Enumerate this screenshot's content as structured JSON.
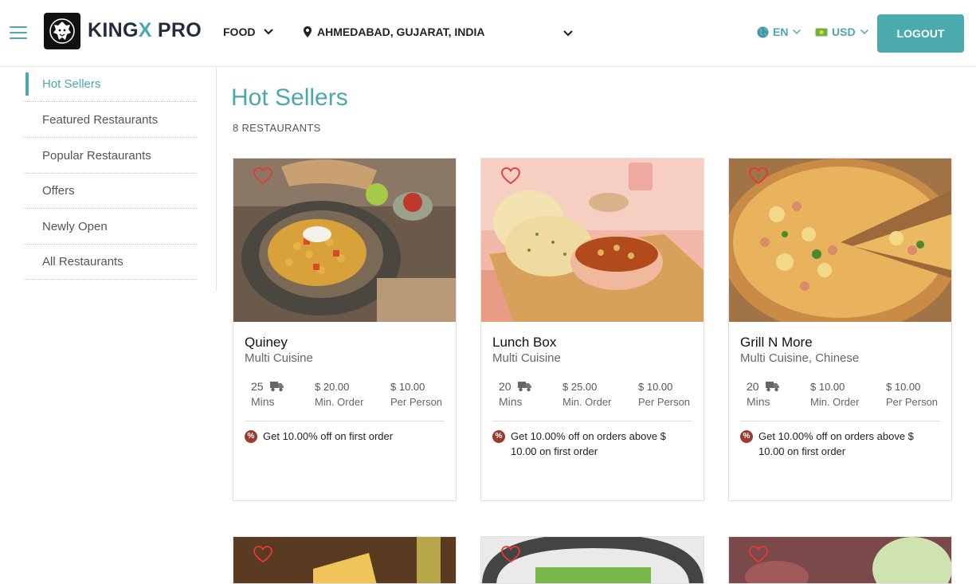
{
  "header": {
    "brand_main": "KINGX",
    "brand_tail": " PRO",
    "service": "FOOD",
    "location": "AHMEDABAD, GUJARAT, INDIA",
    "language": "EN",
    "currency": "USD",
    "logout": "LOGOUT"
  },
  "sidebar": {
    "items": [
      {
        "label": "Hot Sellers"
      },
      {
        "label": "Featured Restaurants"
      },
      {
        "label": "Popular Restaurants"
      },
      {
        "label": "Offers"
      },
      {
        "label": "Newly Open"
      },
      {
        "label": "All Restaurants"
      }
    ]
  },
  "main": {
    "title": "Hot Sellers",
    "count": "8 RESTAURANTS"
  },
  "restaurants": [
    {
      "name": "Quiney",
      "cuisine": "Multi Cuisine",
      "time": "25",
      "time_unit": "Mins",
      "min_order": "$ 20.00",
      "min_order_label": "Min. Order",
      "per_person": "$ 10.00",
      "per_person_label": "Per Person",
      "offer_line1": "Get 10.00% off on first order",
      "offer_line2": ""
    },
    {
      "name": "Lunch Box",
      "cuisine": "Multi Cuisine",
      "time": "20",
      "time_unit": "Mins",
      "min_order": "$ 25.00",
      "min_order_label": "Min. Order",
      "per_person": "$ 10.00",
      "per_person_label": "Per Person",
      "offer_line1": "Get 10.00% off on orders above $",
      "offer_line2": "10.00 on first order"
    },
    {
      "name": "Grill N More",
      "cuisine": "Multi Cuisine, Chinese",
      "time": "20",
      "time_unit": "Mins",
      "min_order": "$ 10.00",
      "min_order_label": "Min. Order",
      "per_person": "$ 10.00",
      "per_person_label": "Per Person",
      "offer_line1": "Get 10.00% off on orders above $",
      "offer_line2": "10.00 on first order"
    }
  ],
  "colors": {
    "accent": "#4aa9ac",
    "heart": "#e53935",
    "offer_icon": "#9b3a30"
  }
}
